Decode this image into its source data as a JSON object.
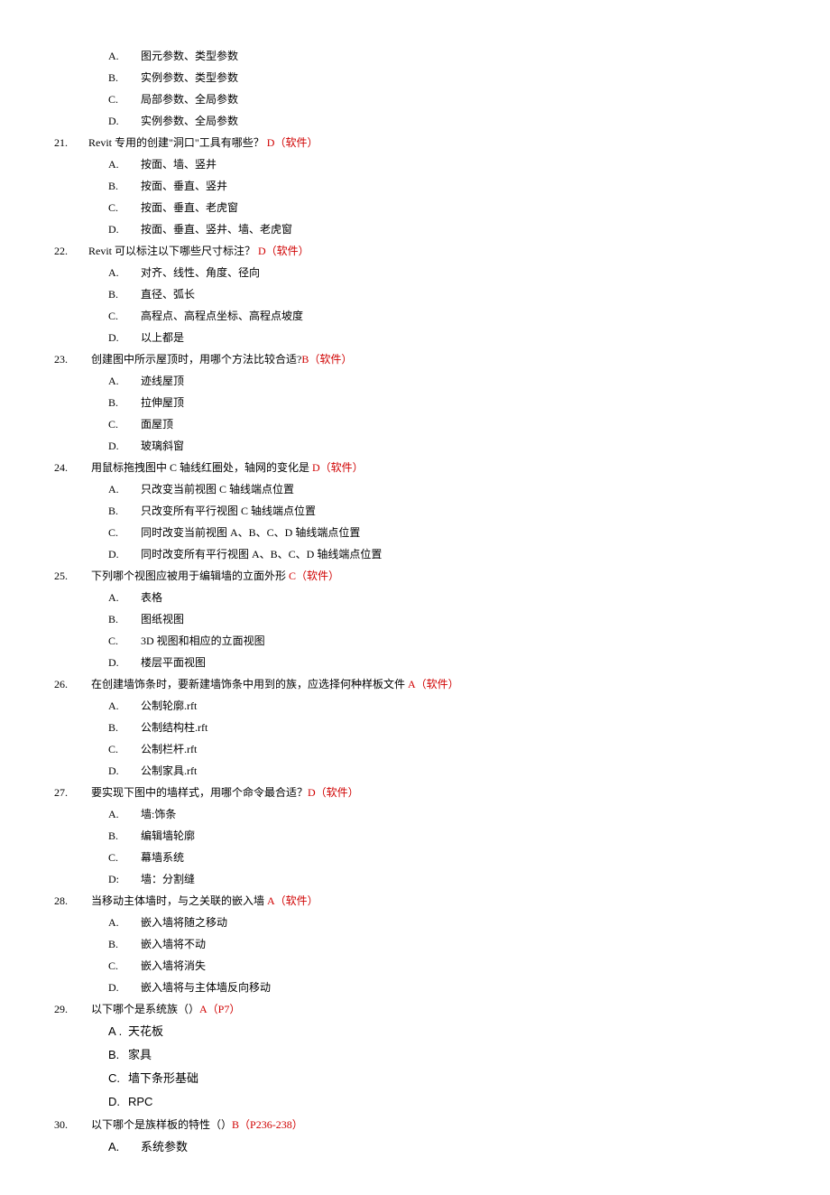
{
  "pre_options": [
    {
      "letter": "A.",
      "text": "图元参数、类型参数"
    },
    {
      "letter": "B.",
      "text": "实例参数、类型参数"
    },
    {
      "letter": "C.",
      "text": "局部参数、全局参数"
    },
    {
      "letter": "D.",
      "text": "实例参数、全局参数"
    }
  ],
  "questions": [
    {
      "num": "21.",
      "text": "Revit 专用的创建\"洞口\"工具有哪些？",
      "answer": "   D（软件）",
      "options": [
        {
          "letter": "A.",
          "text": "按面、墙、竖井"
        },
        {
          "letter": "B.",
          "text": "按面、垂直、竖井"
        },
        {
          "letter": "C.",
          "text": "按面、垂直、老虎窗"
        },
        {
          "letter": "D.",
          "text": "按面、垂直、竖井、墙、老虎窗"
        }
      ]
    },
    {
      "num": "22.",
      "text": "Revit 可以标注以下哪些尺寸标注？",
      "answer": "  D（软件）",
      "options": [
        {
          "letter": "A.",
          "text": "对齐、线性、角度、径向"
        },
        {
          "letter": "B.",
          "text": "直径、弧长"
        },
        {
          "letter": "C.",
          "text": "高程点、高程点坐标、高程点坡度"
        },
        {
          "letter": "D.",
          "text": "以上都是"
        }
      ]
    },
    {
      "num": "23.",
      "text": " 创建图中所示屋顶时，用哪个方法比较合适?",
      "answer": "B（软件）",
      "options": [
        {
          "letter": "A.",
          "text": "迹线屋顶"
        },
        {
          "letter": "B.",
          "text": "拉伸屋顶"
        },
        {
          "letter": "C.",
          "text": "面屋顶"
        },
        {
          "letter": "D.",
          "text": "玻璃斜窗"
        }
      ]
    },
    {
      "num": "24.",
      "text": " 用鼠标拖拽图中 C 轴线红圈处，轴网的变化是",
      "answer": " D（软件）",
      "options": [
        {
          "letter": "A.",
          "text": "只改变当前视图 C 轴线端点位置"
        },
        {
          "letter": "B.",
          "text": "只改变所有平行视图 C 轴线端点位置"
        },
        {
          "letter": "C.",
          "text": "同时改变当前视图 A、B、C、D 轴线端点位置"
        },
        {
          "letter": "D.",
          "text": "同时改变所有平行视图 A、B、C、D 轴线端点位置"
        }
      ]
    },
    {
      "num": "25.",
      "text": " 下列哪个视图应被用于编辑墙的立面外形",
      "answer": "   C（软件）",
      "options": [
        {
          "letter": "A.",
          "text": "表格"
        },
        {
          "letter": "B.",
          "text": "图纸视图"
        },
        {
          "letter": "C.",
          "text": "3D 视图和相应的立面视图"
        },
        {
          "letter": "D.",
          "text": "楼层平面视图"
        }
      ]
    },
    {
      "num": "26.",
      "text": " 在创建墙饰条时，要新建墙饰条中用到的族，应选择何种样板文件",
      "answer": "   A（软件）",
      "options": [
        {
          "letter": "A.",
          "text": "公制轮廓.rft"
        },
        {
          "letter": "B.",
          "text": "公制结构柱.rft"
        },
        {
          "letter": "C.",
          "text": "公制栏杆.rft"
        },
        {
          "letter": "D.",
          "text": "公制家具.rft"
        }
      ]
    },
    {
      "num": "27.",
      "text": " 要实现下图中的墙样式，用哪个命令最合适？",
      "answer": "D（软件）",
      "options": [
        {
          "letter": "A.",
          "text": "墙:饰条"
        },
        {
          "letter": "B.",
          "text": "编辑墙轮廓"
        },
        {
          "letter": "C.",
          "text": "幕墙系统"
        },
        {
          "letter": "D:",
          "text": "墙：分割缝"
        }
      ]
    },
    {
      "num": "28.",
      "text": " 当移动主体墙时，与之关联的嵌入墙",
      "answer": " A（软件）",
      "options": [
        {
          "letter": "A.",
          "text": "嵌入墙将随之移动"
        },
        {
          "letter": "B.",
          "text": "嵌入墙将不动"
        },
        {
          "letter": "C.",
          "text": "嵌入墙将消失"
        },
        {
          "letter": "D.",
          "text": "嵌入墙将与主体墙反向移动"
        }
      ]
    }
  ],
  "q29": {
    "num": "29.",
    "text": " 以下哪个是系统族（）",
    "answer": "A（P7）",
    "options": [
      {
        "letter": "A .",
        "text": "天花板"
      },
      {
        "letter": "B.",
        "text": "家具"
      },
      {
        "letter": "C.",
        "text": "墙下条形基础"
      },
      {
        "letter": "D.",
        "text": "RPC"
      }
    ]
  },
  "q30": {
    "num": "30.",
    "text": " 以下哪个是族样板的特性（）",
    "answer": "B（P236-238）",
    "options": [
      {
        "letter": "A.",
        "text": "系统参数"
      }
    ]
  }
}
